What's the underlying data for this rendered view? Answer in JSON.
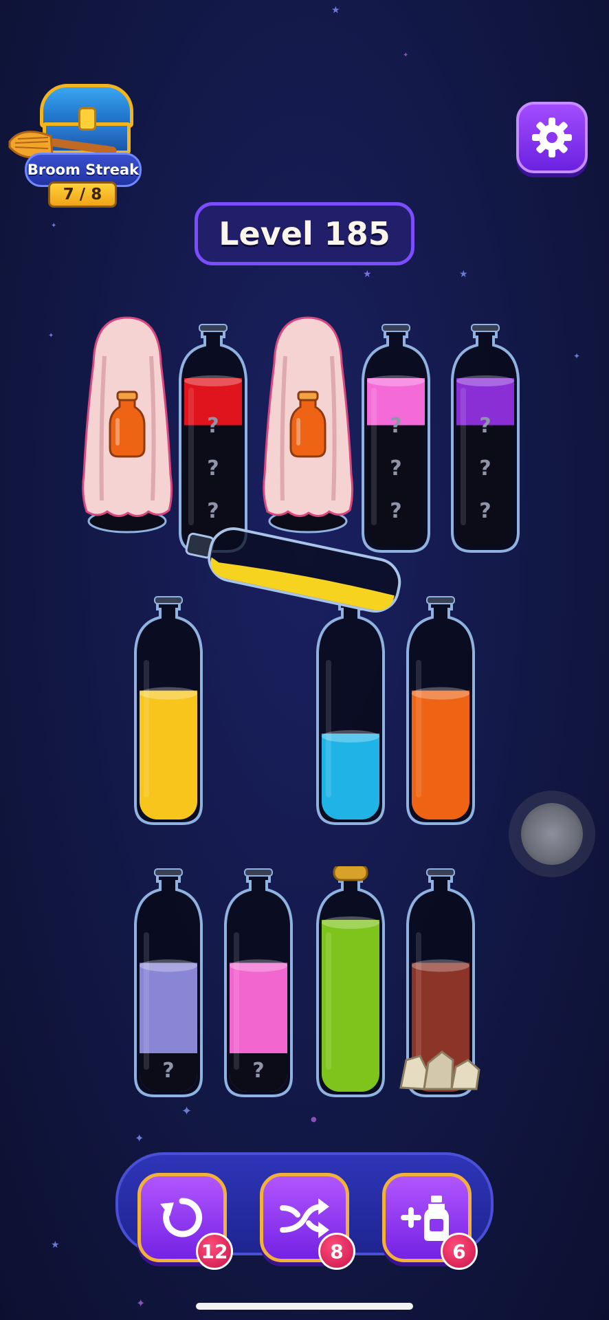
{
  "header": {
    "streak_title": "Broom Streak",
    "streak_count": "7 / 8",
    "settings_icon": "gear-icon"
  },
  "level": {
    "label": "Level 185"
  },
  "bottles": {
    "row1": [
      {
        "id": "b1",
        "state": "covered",
        "cover_icon": "orange-potion-icon"
      },
      {
        "id": "b2",
        "state": "mystery",
        "top_color": "#e0141c",
        "hidden_slots": [
          "?",
          "?",
          "?"
        ]
      },
      {
        "id": "b3",
        "state": "covered",
        "cover_icon": "orange-potion-icon"
      },
      {
        "id": "b4",
        "state": "mystery",
        "top_color": "#f46bd8",
        "hidden_slots": [
          "?",
          "?",
          "?"
        ]
      },
      {
        "id": "b5",
        "state": "mystery",
        "top_color": "#8a2ed6",
        "hidden_slots": [
          "?",
          "?",
          "?"
        ]
      }
    ],
    "pouring": {
      "color": "#f6d31e",
      "fill": 0.3
    },
    "row2": [
      {
        "id": "b6",
        "color": "#f7c51c",
        "fill": 0.75
      },
      {
        "id": "b7",
        "color": "#20b3e6",
        "fill": 0.5
      },
      {
        "id": "b8",
        "color": "#ee6414",
        "fill": 0.75
      }
    ],
    "row3": [
      {
        "id": "b9",
        "color": "#8a86d6",
        "fill": 0.75,
        "hidden_slots": [
          "?"
        ]
      },
      {
        "id": "b10",
        "color": "#f266cf",
        "fill": 0.75,
        "hidden_slots": [
          "?"
        ]
      },
      {
        "id": "b11",
        "color": "#7ec41c",
        "fill": 1.0,
        "state": "corked"
      },
      {
        "id": "b12",
        "color": "#8c3428",
        "fill": 0.75,
        "state": "rubble"
      }
    ]
  },
  "tools": [
    {
      "name": "undo",
      "icon": "undo-arrow-icon",
      "count": "12"
    },
    {
      "name": "shuffle",
      "icon": "shuffle-icon",
      "count": "8"
    },
    {
      "name": "add-bottle",
      "icon": "add-bottle-icon",
      "count": "6"
    }
  ]
}
